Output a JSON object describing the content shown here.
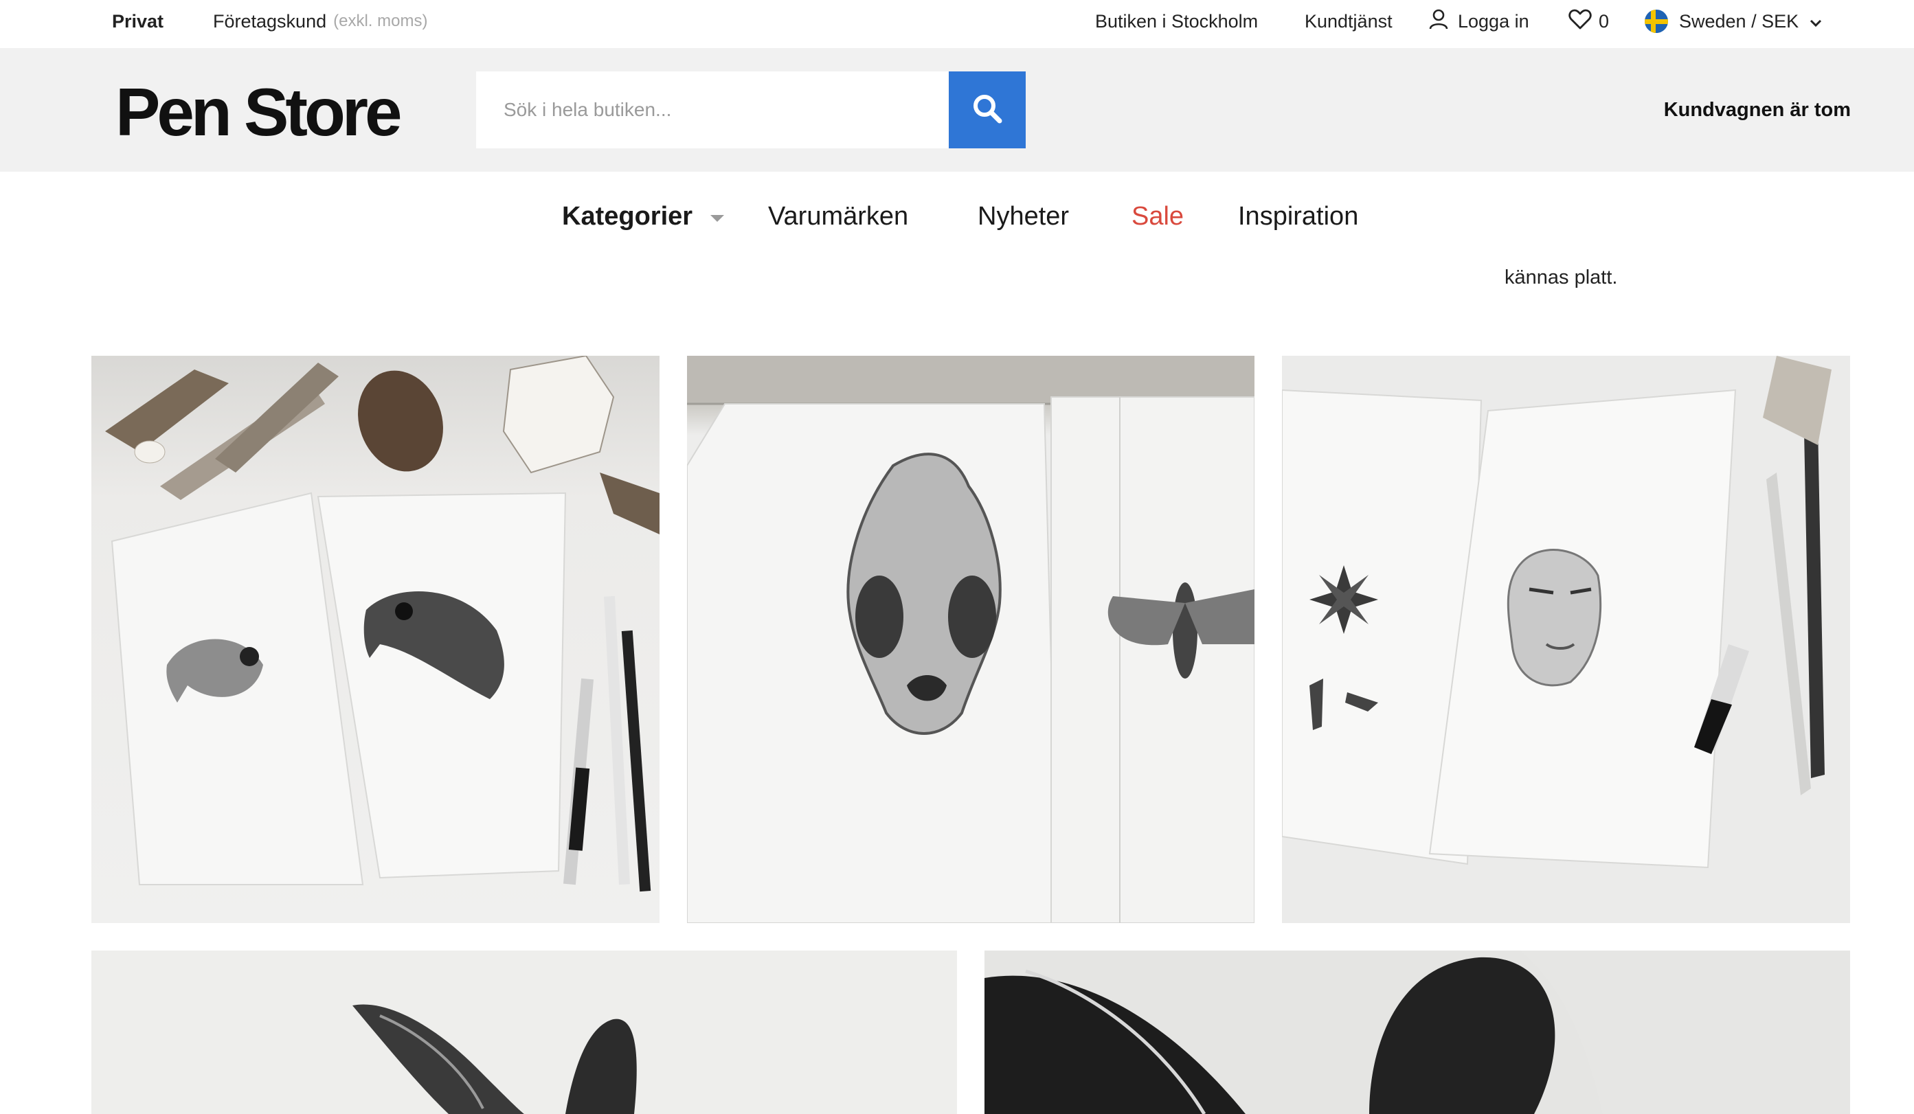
{
  "topbar": {
    "privat": "Privat",
    "foretag": "Företagskund",
    "foretag_note": "(exkl. moms)",
    "store": "Butiken i Stockholm",
    "service": "Kundtjänst",
    "login": "Logga in",
    "wishlist_count": "0",
    "region": "Sweden / SEK",
    "icons": [
      "user-icon",
      "heart-icon",
      "sweden-flag-icon",
      "chevron-down-icon"
    ]
  },
  "header": {
    "logo": "Pen Store",
    "search_placeholder": "Sök i hela butiken...",
    "cart": "Kundvagnen är tom",
    "search_button_color": "#2f76d6"
  },
  "nav": {
    "categories": "Kategorier",
    "brands": "Varumärken",
    "news": "Nyheter",
    "sale": "Sale",
    "inspiration": "Inspiration",
    "sale_color": "#d9493d"
  },
  "content": {
    "snippet": "kännas platt."
  },
  "gallery": {
    "images": [
      "bird-drawings-photo",
      "skull-and-moth-drawings-photo",
      "star-anise-and-face-drawings-photo",
      "deer-ears-drawing-photo",
      "dark-charcoal-ear-drawing-photo"
    ]
  }
}
